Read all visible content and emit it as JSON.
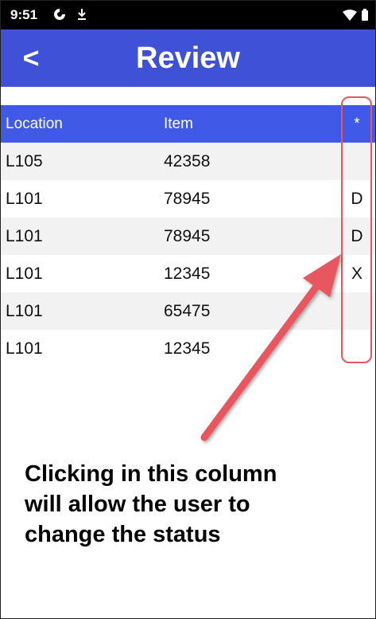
{
  "status_bar": {
    "time": "9:51",
    "icons": [
      "data-saver-icon",
      "download-icon",
      "wifi-icon",
      "battery-icon"
    ]
  },
  "app_bar": {
    "back_label": "<",
    "title": "Review",
    "color": "#3f51d6"
  },
  "grid": {
    "header_color": "#4059e6",
    "headers": {
      "location": "Location",
      "item": "Item",
      "status": "*"
    },
    "rows": [
      {
        "location": "L105",
        "item": "42358",
        "status": ""
      },
      {
        "location": "L101",
        "item": "78945",
        "status": "D"
      },
      {
        "location": "L101",
        "item": "78945",
        "status": "D"
      },
      {
        "location": "L101",
        "item": "12345",
        "status": "X"
      },
      {
        "location": "L101",
        "item": "65475",
        "status": ""
      },
      {
        "location": "L101",
        "item": "12345",
        "status": ""
      }
    ]
  },
  "annotation": {
    "text": "Clicking in this column will allow the user to change the status",
    "color": "#e8575e"
  }
}
